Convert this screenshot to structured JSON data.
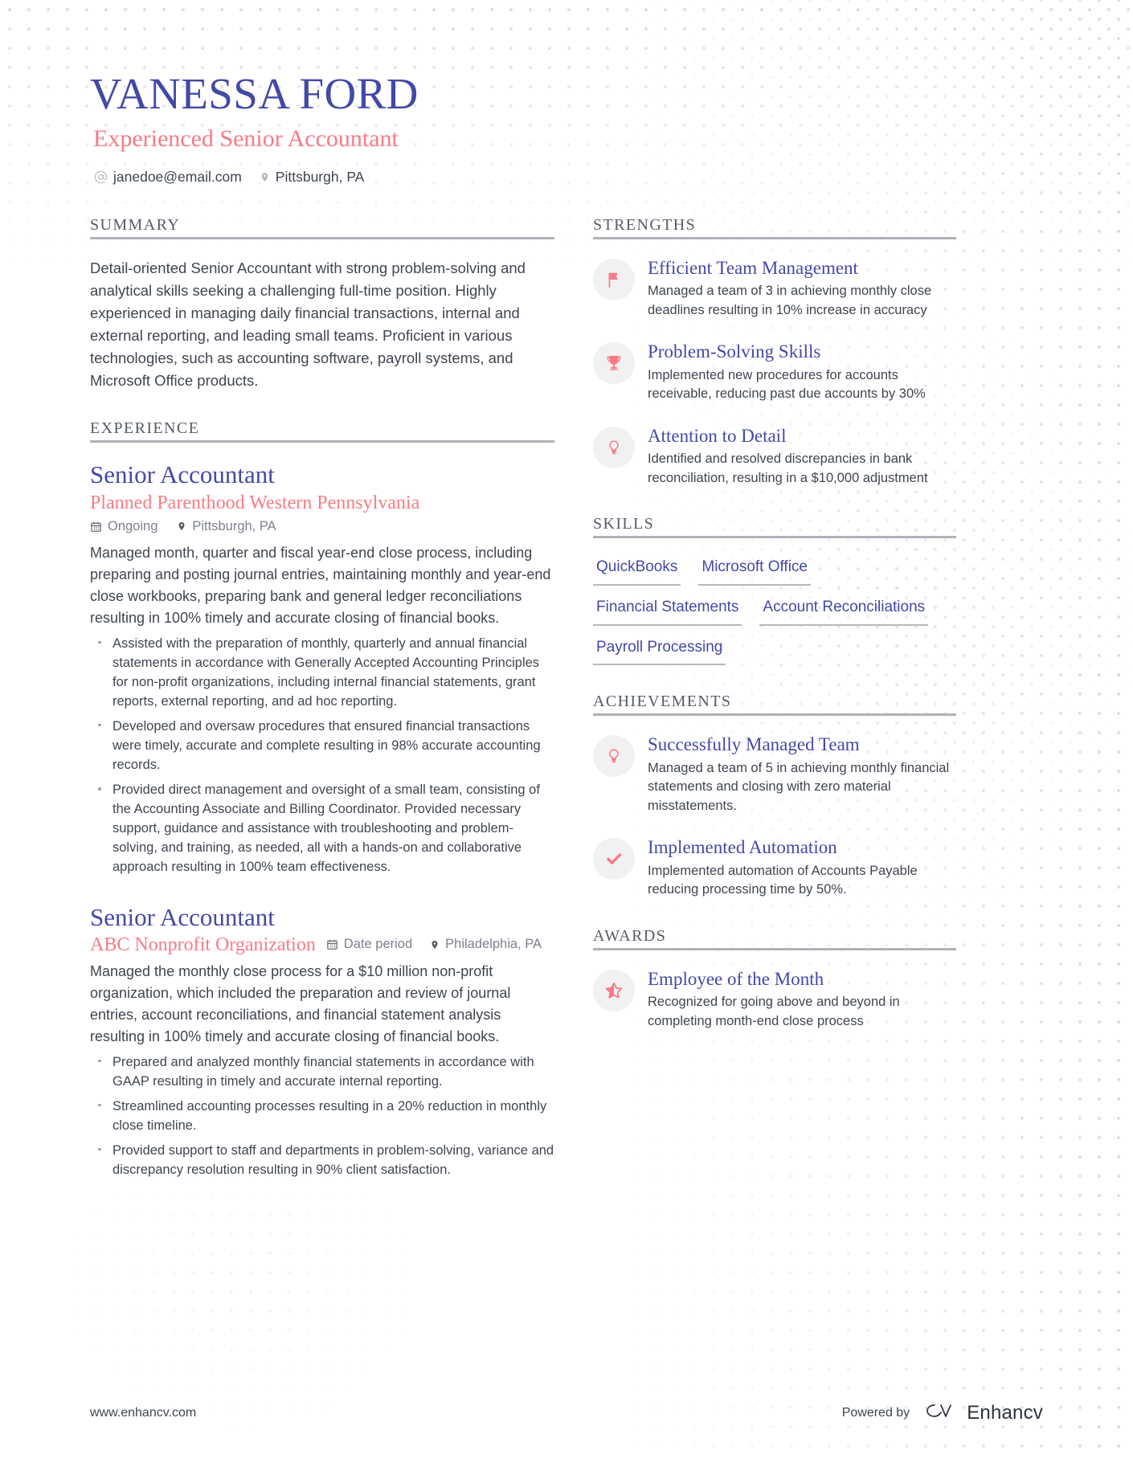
{
  "colors": {
    "primary": "#4349a6",
    "accent": "#fa7b85",
    "text": "#3f4550",
    "muted": "#7b818c",
    "rule": "#b0b2b8",
    "icon_bg": "#f1f1f2"
  },
  "header": {
    "full_name": "VANESSA FORD",
    "job_subtitle": "Experienced Senior Accountant",
    "contacts": [
      {
        "icon": "at-icon",
        "value": "janedoe@email.com"
      },
      {
        "icon": "location-pin-icon",
        "value": "Pittsburgh, PA"
      }
    ]
  },
  "summary": {
    "heading": "SUMMARY",
    "text": "Detail-oriented Senior Accountant with strong problem-solving and analytical skills seeking a challenging full-time position. Highly experienced in managing daily financial transactions, internal and external reporting, and leading small teams. Proficient in various technologies, such as accounting software, payroll systems, and Microsoft Office products."
  },
  "experience": {
    "heading": "EXPERIENCE",
    "items": [
      {
        "title": "Senior Accountant",
        "company": "Planned Parenthood Western Pennsylvania",
        "date": "Ongoing",
        "location": "Pittsburgh, PA",
        "meta_inline": false,
        "description": "Managed month, quarter and fiscal year-end close process, including preparing and posting journal entries, maintaining monthly and year-end close workbooks, preparing bank and general ledger reconciliations resulting in 100% timely and accurate closing of financial books.",
        "bullets": [
          "Assisted with the preparation of monthly, quarterly and annual financial statements in accordance with Generally Accepted Accounting Principles for non-profit organizations, including internal financial statements, grant reports, external reporting, and ad hoc reporting.",
          "Developed and oversaw procedures that ensured financial transactions were timely, accurate and complete resulting in 98% accurate accounting records.",
          "Provided direct management and oversight of a small team, consisting of the Accounting Associate and Billing Coordinator. Provided necessary support, guidance and assistance with troubleshooting and problem-solving, and training, as needed, all with a hands-on and collaborative approach resulting in 100% team effectiveness."
        ]
      },
      {
        "title": "Senior Accountant",
        "company": "ABC Nonprofit Organization",
        "date": "Date period",
        "location": "Philadelphia, PA",
        "meta_inline": true,
        "description": "Managed the monthly close process for a $10 million non-profit organization, which included the preparation and review of journal entries, account reconciliations, and financial statement analysis resulting in 100% timely and accurate closing of financial books.",
        "bullets": [
          "Prepared and analyzed monthly financial statements in accordance with GAAP resulting in timely and accurate internal reporting.",
          "Streamlined accounting processes resulting in a 20% reduction in monthly close timeline.",
          "Provided support to staff and departments in problem-solving, variance and discrepancy resolution resulting in 90% client satisfaction."
        ]
      }
    ]
  },
  "strengths": {
    "heading": "STRENGTHS",
    "items": [
      {
        "icon": "flag-icon",
        "title": "Efficient Team Management",
        "text": "Managed a team of 3 in achieving monthly close deadlines resulting in 10% increase in accuracy"
      },
      {
        "icon": "trophy-icon",
        "title": "Problem-Solving Skills",
        "text": "Implemented new procedures for accounts receivable, reducing past due accounts by 30%"
      },
      {
        "icon": "lightbulb-icon",
        "title": "Attention to Detail",
        "text": "Identified and resolved discrepancies in bank reconciliation, resulting in a $10,000 adjustment"
      }
    ]
  },
  "skills": {
    "heading": "SKILLS",
    "items": [
      "QuickBooks",
      "Microsoft Office",
      "Financial Statements",
      "Account Reconciliations",
      "Payroll Processing"
    ]
  },
  "achievements": {
    "heading": "ACHIEVEMENTS",
    "items": [
      {
        "icon": "lightbulb-icon",
        "title": "Successfully Managed Team",
        "text": "Managed a team of 5 in achieving monthly financial statements and closing with zero material misstatements."
      },
      {
        "icon": "check-icon",
        "title": "Implemented Automation",
        "text": "Implemented automation of Accounts Payable reducing processing time by 50%."
      }
    ]
  },
  "awards": {
    "heading": "AWARDS",
    "items": [
      {
        "icon": "star-icon",
        "title": "Employee of the Month",
        "text": "Recognized for going above and beyond in completing month-end close process"
      }
    ]
  },
  "footer": {
    "url": "www.enhancv.com",
    "powered_by_label": "Powered by",
    "brand_name": "Enhancv",
    "brand_icon": "enhancv-logo-icon"
  }
}
